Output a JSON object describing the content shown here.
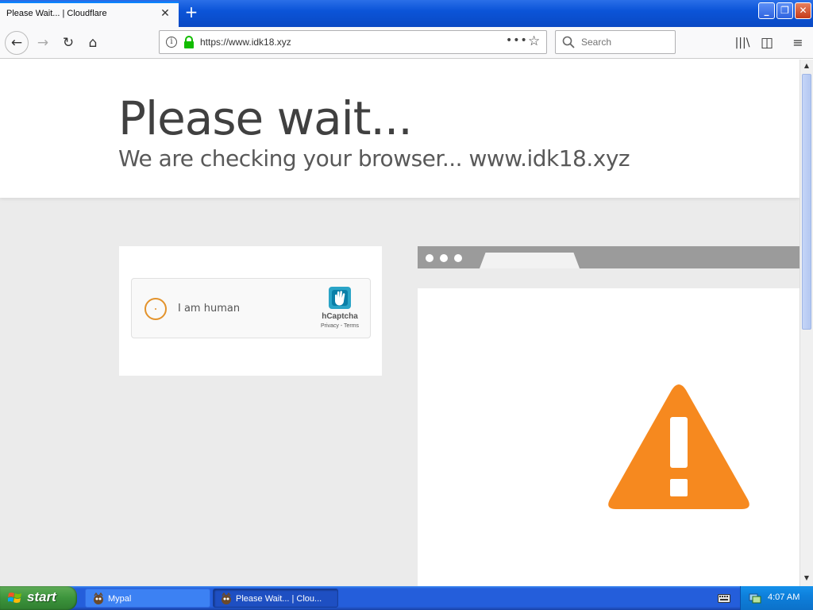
{
  "browser": {
    "tab": {
      "title": "Please Wait... | Cloudflare",
      "close_glyph": "✕"
    },
    "new_tab_glyph": "+",
    "window_buttons": {
      "minimize": "_",
      "maximize": "❐",
      "close": "✕"
    },
    "nav": {
      "back": "←",
      "forward": "→",
      "reload": "↻",
      "home": "⌂"
    },
    "url": "https://www.idk18.xyz",
    "page_actions_glyph": "•••",
    "bookmark_glyph": "☆",
    "search": {
      "placeholder": "Search"
    },
    "toolbar_glyphs": {
      "library": "|||\\",
      "sidebar": "◫",
      "menu": "≡"
    },
    "icons": [
      "info-icon",
      "lock-icon",
      "search-icon",
      "library-icon",
      "sidebar-icon",
      "menu-icon"
    ]
  },
  "page": {
    "heading": "Please wait...",
    "subheading": "We are checking your browser... www.idk18.xyz",
    "captcha": {
      "label": "I am human",
      "brand": "hCaptcha",
      "links": "Privacy - Terms"
    },
    "colors": {
      "warning": "#f6891f",
      "checkbox_ring": "#e3932c",
      "background": "#ebebeb"
    }
  },
  "scrollbar": {
    "up": "▲",
    "down": "▼"
  },
  "taskbar": {
    "start_label": "start",
    "items": [
      {
        "label": "Mypal",
        "active": false
      },
      {
        "label": "Please Wait... | Clou...",
        "active": true
      }
    ],
    "clock": "4:07 AM"
  }
}
